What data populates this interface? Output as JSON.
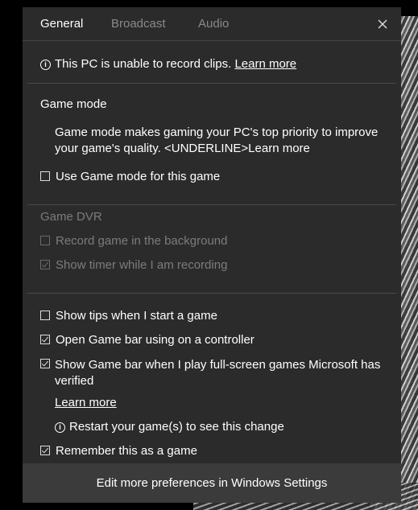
{
  "tabs": [
    {
      "label": "General",
      "active": true
    },
    {
      "label": "Broadcast",
      "active": false
    },
    {
      "label": "Audio",
      "active": false
    }
  ],
  "notice": {
    "text": "This PC is unable to record clips.",
    "link": "Learn more"
  },
  "game_mode": {
    "heading": "Game mode",
    "description": "Game mode makes gaming your PC's top priority to improve your game's quality. <UNDERLINE>Learn more",
    "checkbox_label": "Use Game mode for this game",
    "checked": false
  },
  "game_dvr": {
    "heading": "Game DVR",
    "record_background_label": "Record game in the background",
    "record_background_checked": false,
    "show_timer_label": "Show timer while I am recording",
    "show_timer_checked": true
  },
  "options": {
    "show_tips_label": "Show tips when I start a game",
    "show_tips_checked": false,
    "open_gamebar_label": "Open Game bar using  on a controller",
    "open_gamebar_checked": true,
    "fullscreen_label": "Show Game bar when I play full-screen games Microsoft has verified",
    "fullscreen_checked": true,
    "learn_more": "Learn more",
    "restart_notice": "Restart your game(s) to see this change",
    "remember_label": "Remember this as a game",
    "remember_checked": true
  },
  "footer": {
    "label": "Edit more preferences in Windows Settings"
  }
}
